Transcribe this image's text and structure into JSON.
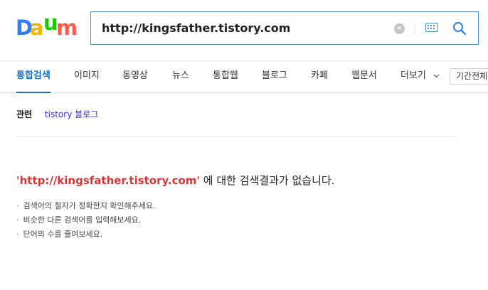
{
  "logo": {
    "letters": [
      "D",
      "a",
      "u",
      "m"
    ],
    "colors": [
      "#2e7cf6",
      "#f5b400",
      "#1ec800",
      "#ff5b49"
    ]
  },
  "search": {
    "query": "http://kingsfather.tistory.com"
  },
  "icons": {
    "clear": "clear-icon",
    "keyboard": "keyboard-icon",
    "search": "search-icon",
    "more": "chevron-down-icon"
  },
  "tabs": [
    "통합검색",
    "이미지",
    "동영상",
    "뉴스",
    "통합웹",
    "블로그",
    "카페",
    "웹문서"
  ],
  "tab_more": "더보기",
  "period": "기간전체",
  "related": {
    "label": "관련",
    "links": [
      "tistory 블로그"
    ]
  },
  "no_result": {
    "query": "'http://kingsfather.tistory.com'",
    "message": " 에 대한 검색결과가 없습니다."
  },
  "tips": [
    "검색어의 철자가 정확한지 확인해주세요.",
    "비슷한 다른 검색어를 입력해보세요.",
    "단어의 수를 줄여보세요."
  ],
  "colors": {
    "accent": "#1a73c8",
    "query_red": "#d93434",
    "related_link": "#3c2ecb",
    "search_border": "#4d8bd0"
  }
}
